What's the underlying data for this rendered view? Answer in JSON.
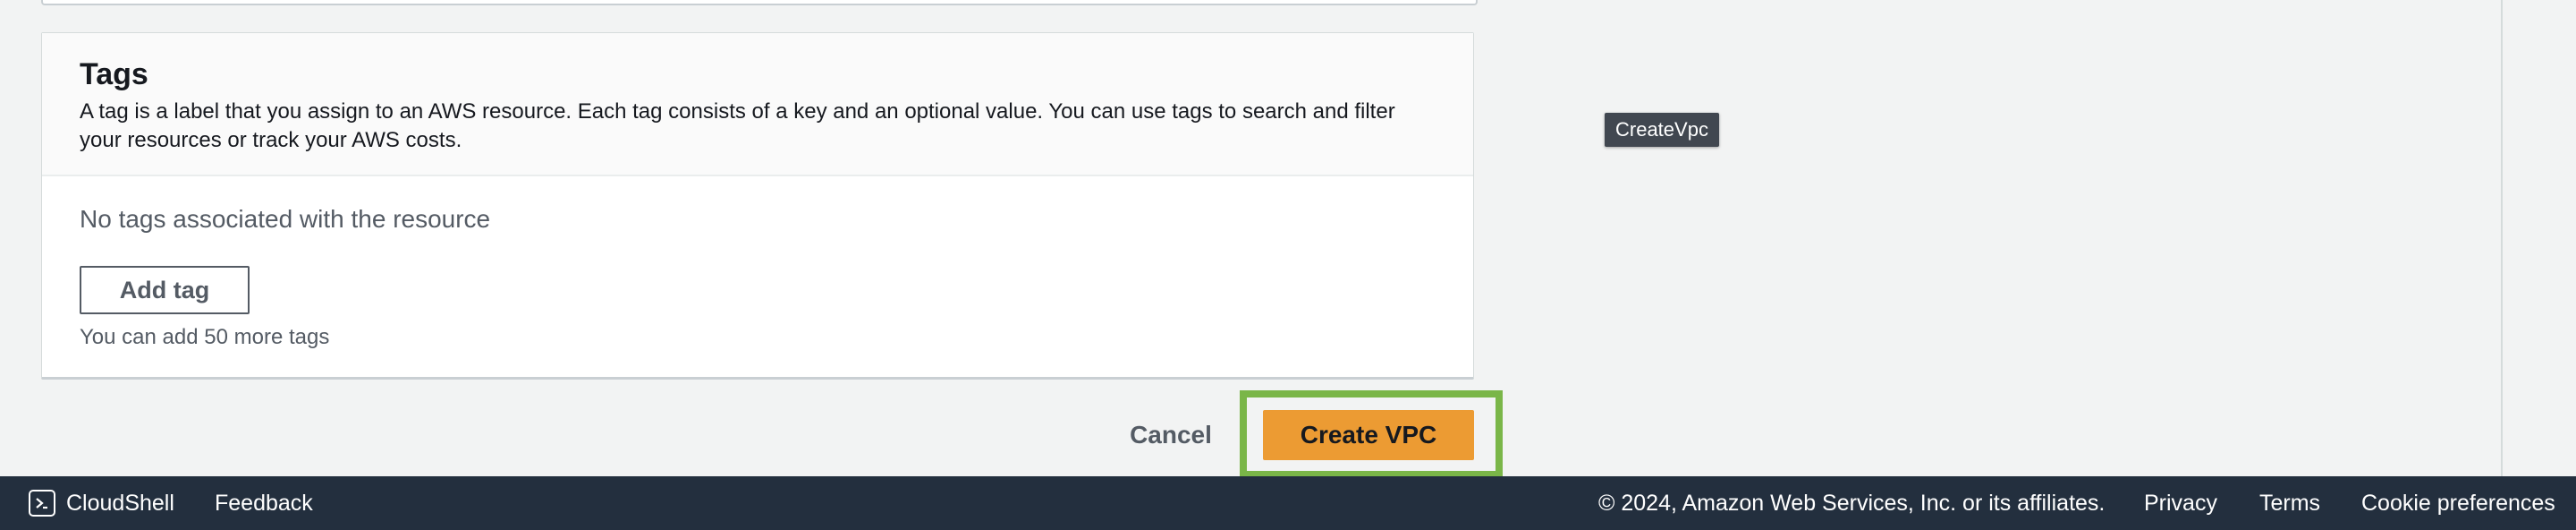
{
  "tags_panel": {
    "title": "Tags",
    "description": "A tag is a label that you assign to an AWS resource. Each tag consists of a key and an optional value. You can use tags to search and filter your resources or track your AWS costs.",
    "empty_message": "No tags associated with the resource",
    "add_tag_label": "Add tag",
    "limit_hint": "You can add 50 more tags"
  },
  "tooltip": {
    "text": "CreateVpc"
  },
  "actions": {
    "cancel_label": "Cancel",
    "create_label": "Create VPC"
  },
  "footer": {
    "cloudshell_label": "CloudShell",
    "feedback_label": "Feedback",
    "copyright": "© 2024, Amazon Web Services, Inc. or its affiliates.",
    "privacy_label": "Privacy",
    "terms_label": "Terms",
    "cookie_label": "Cookie preferences"
  },
  "icons": {
    "cloudshell": "terminal-prompt-icon"
  },
  "colors": {
    "primary_button": "#ec9b33",
    "highlight": "#7ab648",
    "footer_bg": "#232f3e",
    "tooltip_bg": "#414750"
  }
}
